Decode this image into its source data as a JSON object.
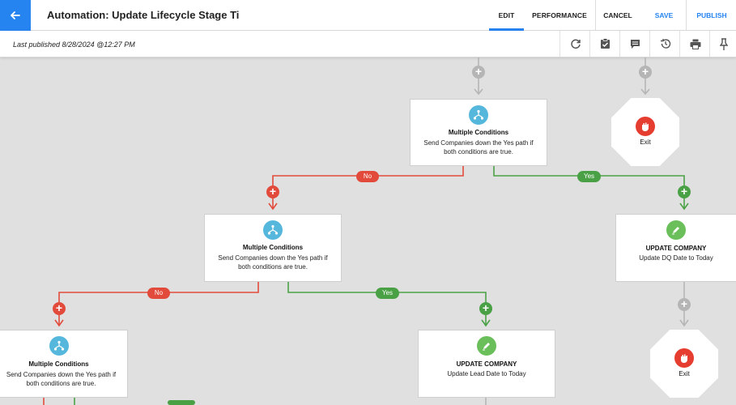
{
  "header": {
    "title": "Automation: Update Lifecycle Stage Ti",
    "tabs": [
      {
        "label": "EDIT",
        "active": true
      },
      {
        "label": "PERFORMANCE",
        "active": false
      }
    ],
    "actions": {
      "cancel": "CANCEL",
      "save": "SAVE",
      "publish": "PUBLISH"
    },
    "accent": "#2684f0"
  },
  "subbar": {
    "published": "Last published 8/28/2024 @12:27 PM",
    "tools": [
      "refresh-icon",
      "checklist-icon",
      "notes-icon",
      "history-icon",
      "print-icon",
      "pin-icon"
    ]
  },
  "flow": {
    "colors": {
      "no": "#e24b3b",
      "yes": "#4aa145",
      "connector": "#b5b5b5",
      "conditions": "#56b7dc",
      "update": "#6abf5b"
    },
    "branch_labels": {
      "no": "No",
      "yes": "Yes"
    },
    "nodes": {
      "cond1": {
        "title": "Multiple Conditions",
        "desc_line1": "Send Companies down the Yes path if",
        "desc_line2": "both conditions are true."
      },
      "cond2": {
        "title": "Multiple Conditions",
        "desc_line1": "Send Companies down the Yes path if",
        "desc_line2": "both conditions are true."
      },
      "cond3": {
        "title": "Multiple Conditions",
        "desc_line1": "Send Companies down the Yes path if",
        "desc_line2": "both conditions are true."
      },
      "update_dq": {
        "title": "UPDATE COMPANY",
        "desc": "Update DQ Date to Today"
      },
      "update_lead": {
        "title": "UPDATE COMPANY",
        "desc": "Update Lead Date to Today"
      },
      "exit1": {
        "label": "Exit"
      },
      "exit2": {
        "label": "Exit"
      }
    }
  }
}
